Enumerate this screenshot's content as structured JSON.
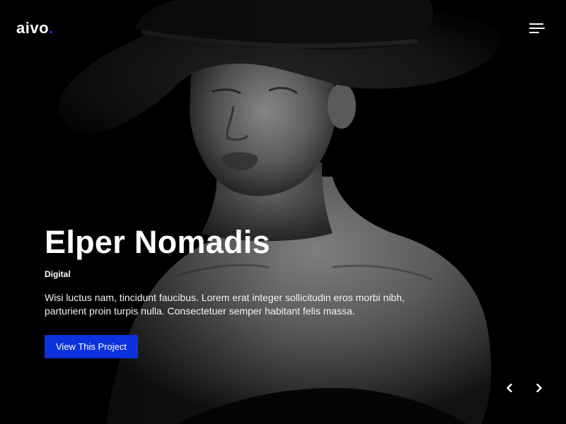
{
  "header": {
    "logo_text": "aivo",
    "logo_dot": ".",
    "menu_icon": "hamburger-menu-icon"
  },
  "hero": {
    "image": "black-and-white portrait of woman wearing wide-brim hat",
    "title": "Elper Nomadis",
    "category": "Digital",
    "description": "Wisi luctus nam, tincidunt faucibus. Lorem erat integer sollicitudin eros morbi nibh, parturient proin turpis nulla. Consectetuer semper habitant felis massa.",
    "cta_label": "View This Project"
  },
  "slider": {
    "prev_icon": "chevron-left-icon",
    "next_icon": "chevron-right-icon"
  },
  "colors": {
    "accent": "#0b32dc",
    "logo_dot": "#1a40e0",
    "background": "#000000",
    "text": "#ffffff"
  }
}
